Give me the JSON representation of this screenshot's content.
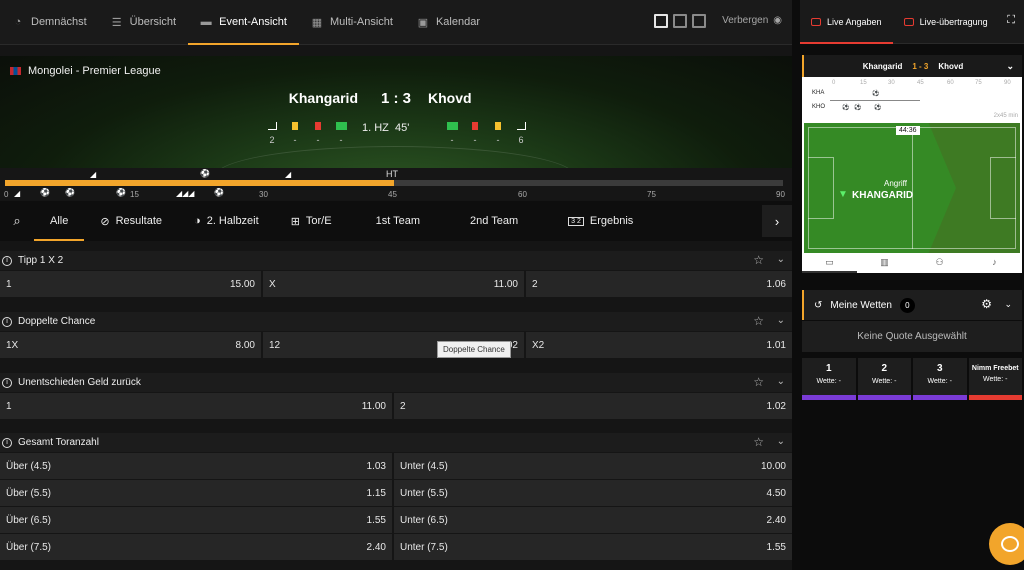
{
  "nav": {
    "tabs": [
      {
        "label": "Demnächst",
        "icon": "clock-icon"
      },
      {
        "label": "Übersicht",
        "icon": "list-icon"
      },
      {
        "label": "Event-Ansicht",
        "icon": "event-view-icon"
      },
      {
        "label": "Multi-Ansicht",
        "icon": "multi-view-icon"
      },
      {
        "label": "Kalendar",
        "icon": "calendar-icon"
      }
    ],
    "active_tab": "Event-Ansicht",
    "hide_label": "Verbergen"
  },
  "event": {
    "league": "Mongolei - Premier League",
    "home": "Khangarid",
    "away": "Khovd",
    "score": "1 : 3",
    "period": "1. HZ",
    "minute": "45'",
    "home_stats": {
      "corners": "2",
      "yellow": "-",
      "red": "-",
      "subs": "-"
    },
    "away_stats": {
      "subs": "-",
      "red": "-",
      "yellow": "-",
      "corners": "6"
    }
  },
  "timeline": {
    "ht_label": "HT",
    "ticks": [
      "0",
      "15",
      "30",
      "45",
      "60",
      "75",
      "90"
    ],
    "progress": 0.5
  },
  "market_tabs": [
    {
      "label": "Alle"
    },
    {
      "label": "Resultate"
    },
    {
      "label": "2. Halbzeit"
    },
    {
      "label": "Tor/E"
    },
    {
      "label": "1st Team"
    },
    {
      "label": "2nd Team"
    },
    {
      "label": "Ergebnis"
    }
  ],
  "markets": [
    {
      "title": "Tipp 1 X 2",
      "rows": [
        [
          {
            "l": "1",
            "o": "15.00"
          },
          {
            "l": "X",
            "o": "11.00"
          },
          {
            "l": "2",
            "o": "1.06"
          }
        ]
      ]
    },
    {
      "title": "Doppelte Chance",
      "rows": [
        [
          {
            "l": "1X",
            "o": "8.00"
          },
          {
            "l": "12",
            "o": "1.02"
          },
          {
            "l": "X2",
            "o": "1.01"
          }
        ]
      ]
    },
    {
      "title": "Unentschieden Geld zurück",
      "rows": [
        [
          {
            "l": "1",
            "o": "11.00"
          },
          {
            "l": "2",
            "o": "1.02"
          }
        ]
      ]
    },
    {
      "title": "Gesamt Toranzahl",
      "rows": [
        [
          {
            "l": "Über (4.5)",
            "o": "1.03"
          },
          {
            "l": "Unter (4.5)",
            "o": "10.00"
          }
        ],
        [
          {
            "l": "Über (5.5)",
            "o": "1.15"
          },
          {
            "l": "Unter (5.5)",
            "o": "4.50"
          }
        ],
        [
          {
            "l": "Über (6.5)",
            "o": "1.55"
          },
          {
            "l": "Unter (6.5)",
            "o": "2.40"
          }
        ],
        [
          {
            "l": "Über (7.5)",
            "o": "2.40"
          },
          {
            "l": "Unter (7.5)",
            "o": "1.55"
          }
        ]
      ]
    }
  ],
  "tooltip": "Doppelte Chance",
  "right": {
    "tabs": [
      {
        "label": "Live Angaben"
      },
      {
        "label": "Live-übertragung"
      }
    ],
    "mini": {
      "home": "Khangarid",
      "away": "Khovd",
      "score": "1 - 3",
      "home_abbr": "KHA",
      "away_abbr": "KHO",
      "minute_marks": [
        "0",
        "15",
        "30",
        "45",
        "60",
        "75",
        "90"
      ],
      "duration": "2x45 min",
      "clock": "44:36",
      "action": "Angriff",
      "team": "KHANGARID"
    },
    "bets": {
      "title": "Meine Wetten",
      "count": "0",
      "empty": "Keine Quote Ausgewählt",
      "slots": [
        {
          "n": "1",
          "w": "Wette: -"
        },
        {
          "n": "2",
          "w": "Wette: -"
        },
        {
          "n": "3",
          "w": "Wette: -"
        },
        {
          "n": "Nimm Freebet",
          "w": "Wette: -"
        }
      ]
    }
  }
}
